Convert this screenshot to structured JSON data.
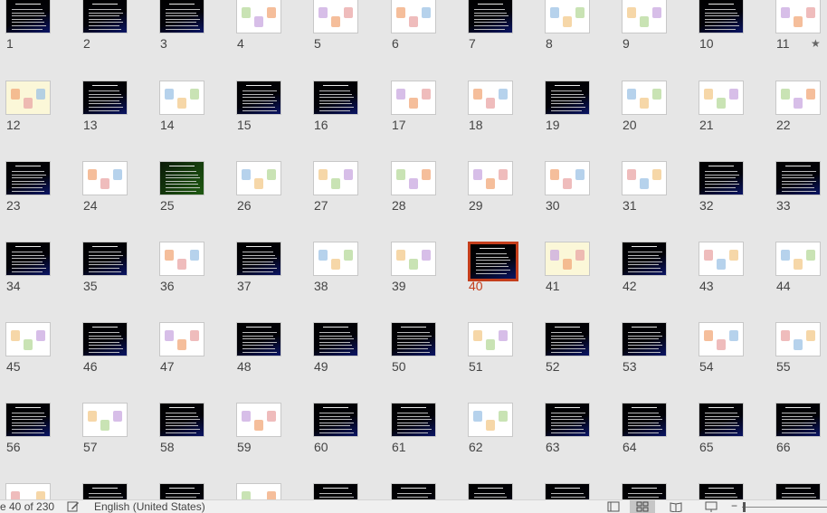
{
  "status_bar": {
    "slide_indicator": "e 40 of 230",
    "language": "English (United States)"
  },
  "selected_slide": "40",
  "accent_color": "#c43e1c",
  "slides": [
    {
      "n": "1",
      "t": "dark",
      "star": false
    },
    {
      "n": "2",
      "t": "dark"
    },
    {
      "n": "3",
      "t": "dark"
    },
    {
      "n": "4",
      "t": "light"
    },
    {
      "n": "5",
      "t": "light"
    },
    {
      "n": "6",
      "t": "light"
    },
    {
      "n": "7",
      "t": "dark"
    },
    {
      "n": "8",
      "t": "light"
    },
    {
      "n": "9",
      "t": "light"
    },
    {
      "n": "10",
      "t": "dark"
    },
    {
      "n": "11",
      "t": "light",
      "star": true
    },
    {
      "n": "12",
      "t": "cream"
    },
    {
      "n": "13",
      "t": "dark"
    },
    {
      "n": "14",
      "t": "light"
    },
    {
      "n": "15",
      "t": "dark"
    },
    {
      "n": "16",
      "t": "dark"
    },
    {
      "n": "17",
      "t": "light"
    },
    {
      "n": "18",
      "t": "light"
    },
    {
      "n": "19",
      "t": "dark"
    },
    {
      "n": "20",
      "t": "light"
    },
    {
      "n": "21",
      "t": "light"
    },
    {
      "n": "22",
      "t": "light"
    },
    {
      "n": "23",
      "t": "dark"
    },
    {
      "n": "24",
      "t": "light"
    },
    {
      "n": "25",
      "t": "green"
    },
    {
      "n": "26",
      "t": "light"
    },
    {
      "n": "27",
      "t": "light"
    },
    {
      "n": "28",
      "t": "light"
    },
    {
      "n": "29",
      "t": "light"
    },
    {
      "n": "30",
      "t": "light"
    },
    {
      "n": "31",
      "t": "light"
    },
    {
      "n": "32",
      "t": "dark"
    },
    {
      "n": "33",
      "t": "dark"
    },
    {
      "n": "34",
      "t": "dark"
    },
    {
      "n": "35",
      "t": "dark"
    },
    {
      "n": "36",
      "t": "light"
    },
    {
      "n": "37",
      "t": "dark"
    },
    {
      "n": "38",
      "t": "light"
    },
    {
      "n": "39",
      "t": "light"
    },
    {
      "n": "40",
      "t": "dark"
    },
    {
      "n": "41",
      "t": "cream"
    },
    {
      "n": "42",
      "t": "dark"
    },
    {
      "n": "43",
      "t": "light"
    },
    {
      "n": "44",
      "t": "light"
    },
    {
      "n": "45",
      "t": "light"
    },
    {
      "n": "46",
      "t": "dark"
    },
    {
      "n": "47",
      "t": "light"
    },
    {
      "n": "48",
      "t": "dark"
    },
    {
      "n": "49",
      "t": "dark"
    },
    {
      "n": "50",
      "t": "dark"
    },
    {
      "n": "51",
      "t": "light"
    },
    {
      "n": "52",
      "t": "dark"
    },
    {
      "n": "53",
      "t": "dark"
    },
    {
      "n": "54",
      "t": "light"
    },
    {
      "n": "55",
      "t": "light"
    },
    {
      "n": "56",
      "t": "dark"
    },
    {
      "n": "57",
      "t": "light"
    },
    {
      "n": "58",
      "t": "dark"
    },
    {
      "n": "59",
      "t": "light"
    },
    {
      "n": "60",
      "t": "dark"
    },
    {
      "n": "61",
      "t": "dark"
    },
    {
      "n": "62",
      "t": "light"
    },
    {
      "n": "63",
      "t": "dark"
    },
    {
      "n": "64",
      "t": "dark"
    },
    {
      "n": "65",
      "t": "dark"
    },
    {
      "n": "66",
      "t": "dark"
    },
    {
      "n": "",
      "t": "light"
    },
    {
      "n": "",
      "t": "dark"
    },
    {
      "n": "",
      "t": "dark"
    },
    {
      "n": "",
      "t": "light"
    },
    {
      "n": "",
      "t": "dark"
    },
    {
      "n": "",
      "t": "dark"
    },
    {
      "n": "",
      "t": "dark"
    },
    {
      "n": "",
      "t": "dark"
    },
    {
      "n": "",
      "t": "dark"
    },
    {
      "n": "",
      "t": "dark"
    },
    {
      "n": "",
      "t": "dark"
    }
  ],
  "view_buttons": [
    {
      "name": "normal-view-icon",
      "active": false
    },
    {
      "name": "slide-sorter-icon",
      "active": true
    },
    {
      "name": "reading-view-icon",
      "active": false
    },
    {
      "name": "slide-show-icon",
      "active": false
    }
  ]
}
